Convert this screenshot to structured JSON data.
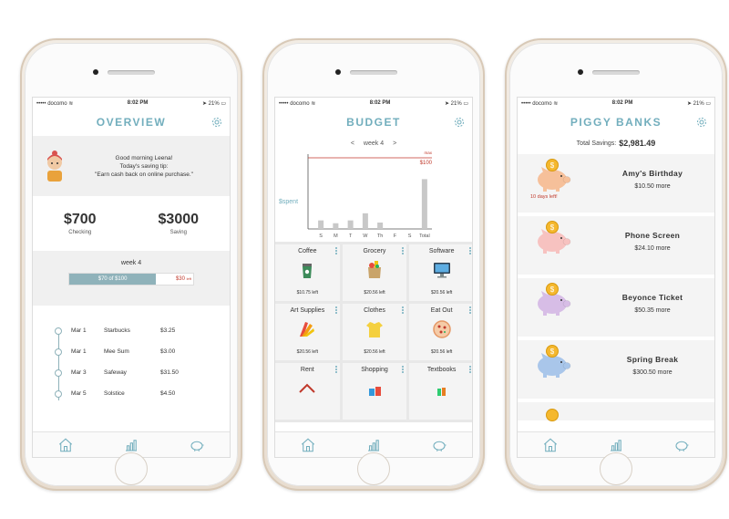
{
  "status": {
    "carrier": "docomo",
    "time": "8:02 PM",
    "battery": "21%"
  },
  "overview": {
    "title": "OVERVIEW",
    "greeting": "Good morning Leena!",
    "tip_label": "Today's saving tip:",
    "tip": "\"Earn cash back on online purchase.\"",
    "checking": {
      "value": "$700",
      "label": "Checking"
    },
    "saving": {
      "value": "$3000",
      "label": "Saving"
    },
    "week": "week 4",
    "progress": {
      "text": "$70 of $100",
      "remaining": "$30",
      "remaining_suffix": "left",
      "fraction": 0.7
    },
    "transactions": [
      {
        "date": "Mar 1",
        "merchant": "Starbucks",
        "amount": "$3.25"
      },
      {
        "date": "Mar 1",
        "merchant": "Mee Sum",
        "amount": "$3.00"
      },
      {
        "date": "Mar 3",
        "merchant": "Safeway",
        "amount": "$31.50"
      },
      {
        "date": "Mar 5",
        "merchant": "Solstice",
        "amount": "$4.50"
      }
    ]
  },
  "budget": {
    "title": "BUDGET",
    "week": "week 4",
    "prev": "<",
    "next": ">",
    "chart_data": {
      "type": "bar",
      "categories": [
        "S",
        "M",
        "T",
        "W",
        "Th",
        "F",
        "S",
        "Total"
      ],
      "values": [
        12,
        8,
        12,
        22,
        9,
        0,
        0,
        70
      ],
      "ylim": [
        0,
        100
      ],
      "ylabel": "$spent",
      "max_label": "max",
      "max_value_label": "$100",
      "max_value": 100,
      "max_color": "#c0392b"
    },
    "categories": [
      {
        "name": "Coffee",
        "left": "$10.75 left",
        "icon": "coffee-cup-icon"
      },
      {
        "name": "Grocery",
        "left": "$20.56 left",
        "icon": "grocery-bag-icon"
      },
      {
        "name": "Software",
        "left": "$20.56 left",
        "icon": "monitor-icon"
      },
      {
        "name": "Art Supplies",
        "left": "$20.56 left",
        "icon": "color-swatch-icon"
      },
      {
        "name": "Clothes",
        "left": "$20.56 left",
        "icon": "shirt-icon"
      },
      {
        "name": "Eat Out",
        "left": "$20.56 left",
        "icon": "pizza-icon"
      },
      {
        "name": "Rent",
        "left": "",
        "icon": "house-icon"
      },
      {
        "name": "Shopping",
        "left": "",
        "icon": "shopping-icon"
      },
      {
        "name": "Textbooks",
        "left": "",
        "icon": "books-icon"
      }
    ]
  },
  "piggy": {
    "title": "PIGGY BANKS",
    "total_label": "Total Savings:",
    "total": "$2,981.49",
    "banks": [
      {
        "name": "Amy's Birthday",
        "more": "$10.50 more",
        "deadline": "10 days left!",
        "color": "#f6c09a"
      },
      {
        "name": "Phone Screen",
        "more": "$24.10 more",
        "deadline": "",
        "color": "#f7c2c0"
      },
      {
        "name": "Beyonce Ticket",
        "more": "$50.35 more",
        "deadline": "",
        "color": "#d7bde6"
      },
      {
        "name": "Spring Break",
        "more": "$300.50 more",
        "deadline": "",
        "color": "#a9c6ea"
      }
    ]
  },
  "colors": {
    "accent": "#72aebd",
    "progress": "#8fb2ba",
    "alert": "#c0392b"
  }
}
